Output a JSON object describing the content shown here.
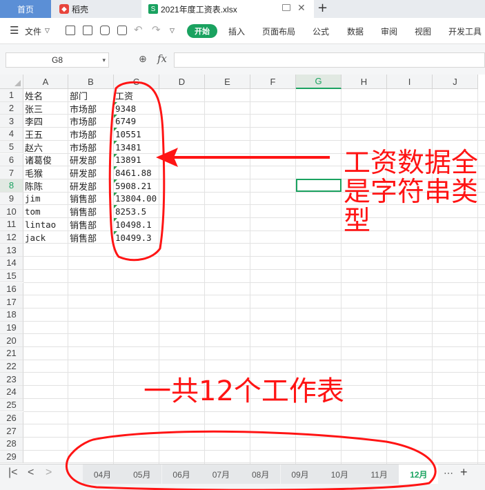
{
  "tabs": {
    "home": "首页",
    "docer": "稻壳",
    "file": "2021年度工资表.xlsx"
  },
  "ribbon": {
    "file_menu": "文件",
    "items": [
      "开始",
      "插入",
      "页面布局",
      "公式",
      "数据",
      "审阅",
      "视图",
      "开发工具"
    ]
  },
  "formula_bar": {
    "cell_ref": "G8",
    "fx": "fx",
    "value": ""
  },
  "columns": [
    "A",
    "B",
    "C",
    "D",
    "E",
    "F",
    "G",
    "H",
    "I",
    "J"
  ],
  "selected_column": "G",
  "selected_row": "8",
  "rows": [
    "1",
    "2",
    "3",
    "4",
    "5",
    "6",
    "7",
    "8",
    "9",
    "10",
    "11",
    "12",
    "13",
    "14",
    "15",
    "16",
    "17",
    "18",
    "19",
    "20",
    "21",
    "22",
    "23",
    "24",
    "25",
    "26",
    "27",
    "28",
    "29"
  ],
  "table": [
    [
      "姓名",
      "部门",
      "工资"
    ],
    [
      "张三",
      "市场部",
      "9348"
    ],
    [
      "李四",
      "市场部",
      "6749"
    ],
    [
      "王五",
      "市场部",
      "10551"
    ],
    [
      "赵六",
      "市场部",
      "13481"
    ],
    [
      "诸葛俊",
      "研发部",
      "13891"
    ],
    [
      "毛猴",
      "研发部",
      "8461.88"
    ],
    [
      "陈陈",
      "研发部",
      "5908.21"
    ],
    [
      "jim",
      "销售部",
      "13804.00"
    ],
    [
      "tom",
      "销售部",
      "8253.5"
    ],
    [
      "lintao",
      "销售部",
      "10498.1"
    ],
    [
      "jack",
      "销售部",
      "10499.3"
    ]
  ],
  "sheets": [
    "04月",
    "05月",
    "06月",
    "07月",
    "08月",
    "09月",
    "10月",
    "11月",
    "12月"
  ],
  "active_sheet": "12月",
  "annotations": {
    "right_note": "工资数据全是字符串类型",
    "bottom_note": "一共12个工作表"
  },
  "colors": {
    "accent": "#1aa260",
    "annotation": "#ff1414"
  }
}
